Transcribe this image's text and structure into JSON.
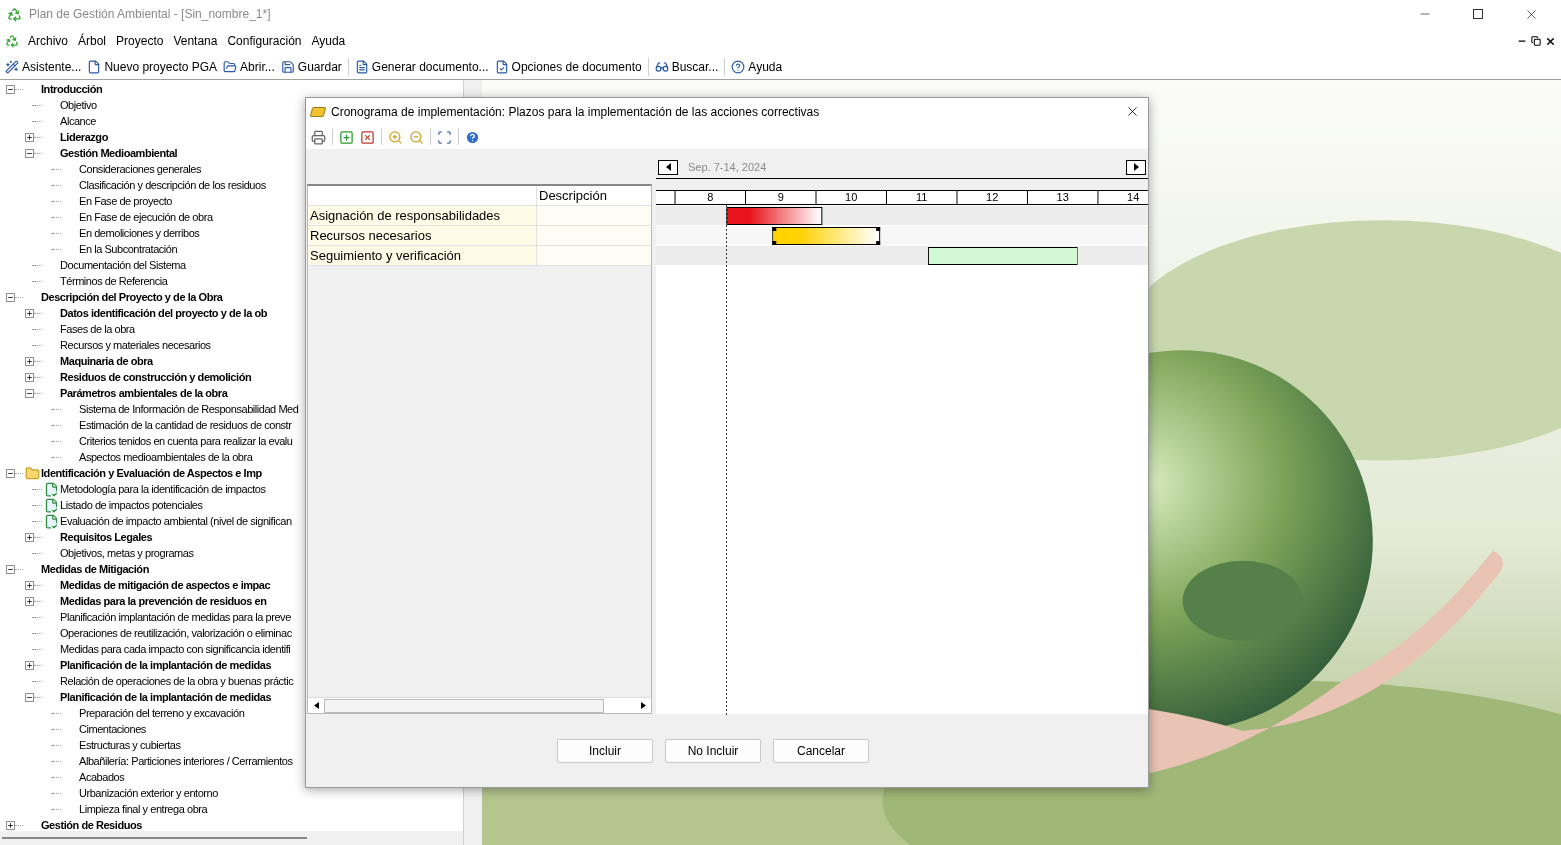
{
  "window": {
    "title": "Plan de Gestión Ambiental - [Sin_nombre_1*]"
  },
  "menu": [
    "Archivo",
    "Árbol",
    "Proyecto",
    "Ventana",
    "Configuración",
    "Ayuda"
  ],
  "toolbar": [
    [
      "Asistente...",
      "Nuevo proyecto PGA",
      "Abrir...",
      "Guardar"
    ],
    [
      "Generar documento...",
      "Opciones de documento"
    ],
    [
      "Buscar..."
    ],
    [
      "Ayuda"
    ]
  ],
  "tree": [
    {
      "label": "Introducción",
      "bold": true,
      "expanded": true,
      "children": [
        {
          "label": "Objetivo"
        },
        {
          "label": "Alcance"
        },
        {
          "label": "Liderazgo",
          "bold": true,
          "expanded": false
        },
        {
          "label": "Gestión Medioambiental",
          "bold": true,
          "expanded": true,
          "children": [
            {
              "label": "Consideraciones generales"
            },
            {
              "label": "Clasificación y descripción de los residuos"
            },
            {
              "label": "En Fase de proyecto"
            },
            {
              "label": "En Fase de ejecución de obra"
            },
            {
              "label": "En demoliciones y derribos"
            },
            {
              "label": "En la Subcontratación"
            }
          ]
        },
        {
          "label": "Documentación del Sistema"
        },
        {
          "label": "Términos de Referencia"
        }
      ]
    },
    {
      "label": "Descripción del Proyecto y de la Obra",
      "bold": true,
      "expanded": true,
      "children": [
        {
          "label": "Datos identificación del proyecto y de la ob",
          "bold": true,
          "expanded": false
        },
        {
          "label": "Fases de la obra"
        },
        {
          "label": "Recursos y materiales necesarios"
        },
        {
          "label": "Maquinaria de obra",
          "bold": true,
          "expanded": false
        },
        {
          "label": "Residuos de construcción y demolición",
          "bold": true,
          "expanded": false
        },
        {
          "label": "Parámetros ambientales de la obra",
          "bold": true,
          "expanded": true,
          "children": [
            {
              "label": "Sistema de Información de Responsabilidad Med"
            },
            {
              "label": "Estimación de la cantidad de residuos de constr"
            },
            {
              "label": "Criterios tenidos en cuenta para realizar la evalu"
            },
            {
              "label": "Aspectos medioambientales de la obra"
            }
          ]
        }
      ]
    },
    {
      "label": "Identificación y Evaluación de Aspectos e Imp",
      "bold": true,
      "expanded": true,
      "kind": "folder",
      "children": [
        {
          "label": "Metodología para la identificación de impactos",
          "kind": "document"
        },
        {
          "label": "Listado de impactos potenciales",
          "kind": "document"
        },
        {
          "label": "Evaluación de impacto ambiental (nivel de significan",
          "kind": "document"
        },
        {
          "label": "Requisitos Legales",
          "bold": true,
          "expanded": false
        },
        {
          "label": "Objetivos, metas y programas"
        }
      ]
    },
    {
      "label": "Medidas de Mitigación",
      "bold": true,
      "expanded": true,
      "children": [
        {
          "label": "Medidas de mitigación de aspectos e impac",
          "bold": true,
          "expanded": false
        },
        {
          "label": "Medidas para la prevención de residuos en",
          "bold": true,
          "expanded": false
        },
        {
          "label": "Planificación implantación de medidas para la preve"
        },
        {
          "label": "Operaciones de reutilización, valorización o eliminac"
        },
        {
          "label": "Medidas para cada impacto con significancia identifi"
        },
        {
          "label": "Planificación de la implantación de medidas",
          "bold": true,
          "expanded": false
        },
        {
          "label": "Relación de operaciones de la obra y buenas práctic"
        },
        {
          "label": "Planificación de la implantación de medidas",
          "bold": true,
          "expanded": true,
          "children": [
            {
              "label": "Preparación del terreno y excavación"
            },
            {
              "label": "Cimentaciones"
            },
            {
              "label": "Estructuras y cubiertas"
            },
            {
              "label": "Albañilería: Particiones interiores / Cerramientos"
            },
            {
              "label": "Acabados"
            },
            {
              "label": "Urbanización exterior y entorno"
            },
            {
              "label": "Limpieza final y entrega obra"
            }
          ]
        }
      ]
    },
    {
      "label": "Gestión de Residuos",
      "bold": true,
      "expanded": false
    }
  ],
  "dialog": {
    "title": "Cronograma de implementación: Plazos para la implementación de las acciones correctivas",
    "period": "Sep. 7-14, 2024",
    "grid_columns": [
      "Descripción"
    ],
    "tasks": [
      {
        "name": "Asignación de responsabilidades",
        "color": "#e8141b",
        "selected": false
      },
      {
        "name": "Recursos necesarios",
        "color": "#ffd200",
        "selected": true
      },
      {
        "name": "Seguimiento y verificación",
        "color": "#d4f7d4",
        "selected": false
      }
    ],
    "timeline": {
      "days": [
        "8",
        "9",
        "10",
        "11",
        "12",
        "13",
        "14"
      ]
    },
    "buttons": [
      "Incluir",
      "No Incluir",
      "Cancelar"
    ]
  }
}
